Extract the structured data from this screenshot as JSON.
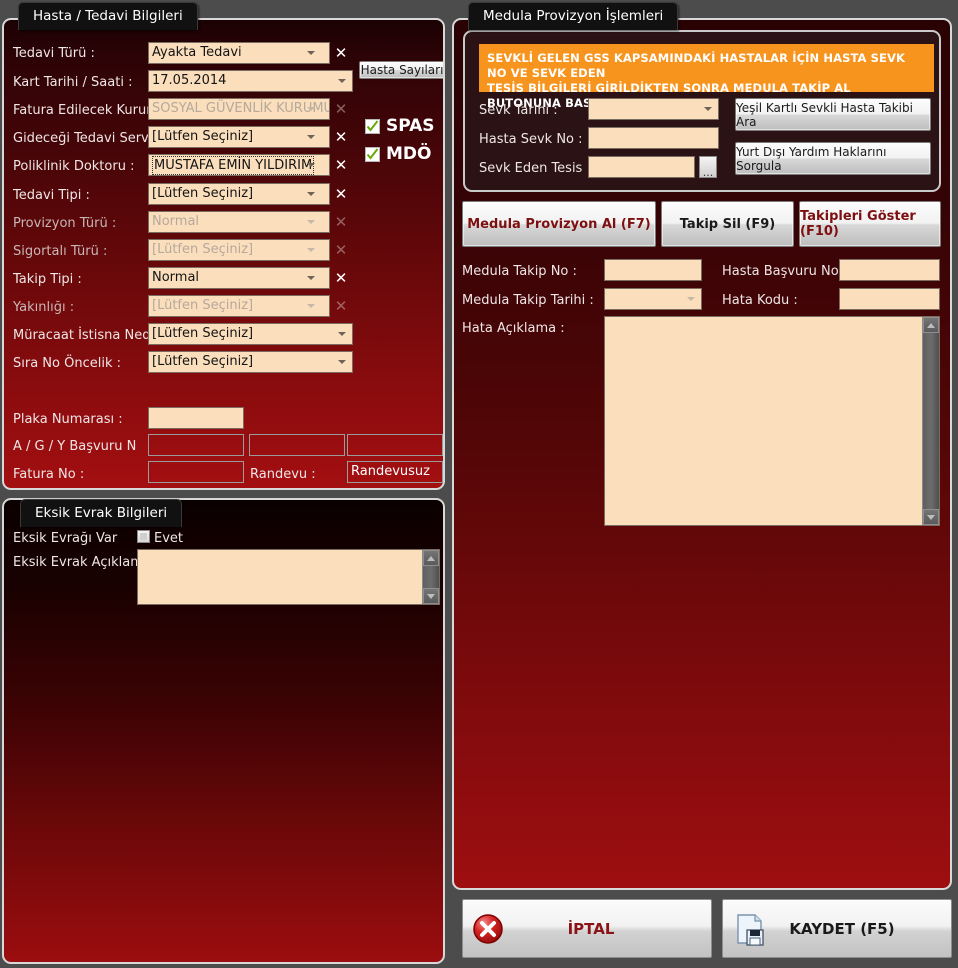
{
  "panels": {
    "left_top_title": "Hasta / Tedavi Bilgileri",
    "left_bottom_title": "Eksik Evrak Bilgileri",
    "right_title": "Medula Provizyon İşlemleri"
  },
  "colors": {
    "panel_red": "#8c0c0e",
    "field_bg": "#fbdfbd",
    "banner_orange": "#f7941d",
    "accent_dark_red": "#7d0f10",
    "check_green": "#6aa80b"
  },
  "hasta_tedavi": {
    "rows": [
      {
        "label": "Tedavi Türü :",
        "value": "Ayakta Tedavi",
        "disabled": false,
        "caret": true,
        "clear": true
      },
      {
        "label": "Kart Tarihi / Saati :",
        "value": "17.05.2014",
        "disabled": false,
        "caret": true,
        "clear": false
      },
      {
        "label": "Fatura Edilecek Kurum :",
        "value": "SOSYAL GÜVENLİK KURUMU (SGK)",
        "disabled": true,
        "caret": true,
        "clear": true
      },
      {
        "label": "Gideceği Tedavi Servisi :",
        "value": "[Lütfen Seçiniz]",
        "disabled": false,
        "caret": true,
        "clear": true
      },
      {
        "label": "Poliklinik Doktoru :",
        "value": "MUSTAFA EMİN YILDIRIM",
        "disabled": false,
        "caret": true,
        "clear": true,
        "focused": true
      },
      {
        "label": "Tedavi Tipi  :",
        "value": "[Lütfen Seçiniz]",
        "disabled": false,
        "caret": true,
        "clear": true
      },
      {
        "label": "Provizyon Türü :",
        "value": "Normal",
        "disabled": true,
        "caret": true,
        "clear": true
      },
      {
        "label": "Sigortalı Türü :",
        "value": "[Lütfen Seçiniz]",
        "disabled": true,
        "caret": true,
        "clear": true
      },
      {
        "label": "Takip Tipi :",
        "value": "Normal",
        "disabled": false,
        "caret": true,
        "clear": true
      },
      {
        "label": "Yakınlığı :",
        "value": "[Lütfen Seçiniz]",
        "disabled": true,
        "caret": true,
        "clear": true
      },
      {
        "label": "Müracaat İstisna Nedeni",
        "value": "[Lütfen Seçiniz]",
        "disabled": false,
        "caret": true,
        "clear": false
      },
      {
        "label": "Sıra No Öncelik   :",
        "value": "[Lütfen Seçiniz]",
        "disabled": false,
        "caret": true,
        "clear": false
      }
    ],
    "hasta_sayilari_button": "Hasta Sayıları",
    "checkboxes": [
      {
        "label": "SPAS",
        "checked": true
      },
      {
        "label": "MDÖ",
        "checked": true
      }
    ],
    "plaka_label": "Plaka Numarası :",
    "plaka_value": "",
    "agy_label": "A / G / Y Başvuru N",
    "agy_values": [
      "",
      "",
      ""
    ],
    "fatura_label": "Fatura No :",
    "fatura_value": "",
    "randevu_label": "Randevu :",
    "randevu_value": "Randevusuz"
  },
  "eksik_evrak": {
    "var_label": "Eksik Evrağı Var",
    "evet_label": "Evet",
    "evet_checked": false,
    "aciklama_label": "Eksik Evrak Açıklaması",
    "aciklama_value": ""
  },
  "medula": {
    "banner_line1": "SEVKLİ GELEN GSS KAPSAMINDAKİ HASTALAR İÇİN  HASTA SEVK NO VE SEVK EDEN",
    "banner_line2": "TESİS BİLGİLERİ GİRİLDİKTEN SONRA MEDULA TAKİP AL BUTONUNA BASINIZ!!",
    "sevk_rows": [
      {
        "label": "Sevk Tarihi :",
        "value": "",
        "caret": true,
        "ellipsis": false
      },
      {
        "label": "Hasta Sevk No :",
        "value": "",
        "caret": false,
        "ellipsis": false
      },
      {
        "label": "Sevk Eden Tesis :",
        "value": "",
        "caret": false,
        "ellipsis": true
      }
    ],
    "ellipsis_label": "...",
    "side_buttons": [
      "Yeşil Kartlı Sevkli Hasta Takibi Ara",
      "Yurt Dışı Yardım Haklarını Sorgula"
    ],
    "action_buttons": [
      {
        "label": "Medula Provizyon Al (F7)",
        "accent": true
      },
      {
        "label": "Takip Sil (F9)",
        "accent": false
      },
      {
        "label": "Takipleri Göster (F10)",
        "accent": true
      }
    ],
    "takip_no_label": "Medula Takip No :",
    "takip_no_value": "",
    "takip_tarihi_label": "Medula Takip Tarihi :",
    "takip_tarihi_value": "",
    "basvuru_no_label": "Hasta Başvuru No",
    "basvuru_no_value": "",
    "hata_kodu_label": "Hata Kodu :",
    "hata_kodu_value": "",
    "hata_aciklama_label": "Hata Açıklama :",
    "hata_aciklama_value": ""
  },
  "footer": {
    "cancel_label": "İPTAL",
    "save_label": "KAYDET (F5)"
  }
}
